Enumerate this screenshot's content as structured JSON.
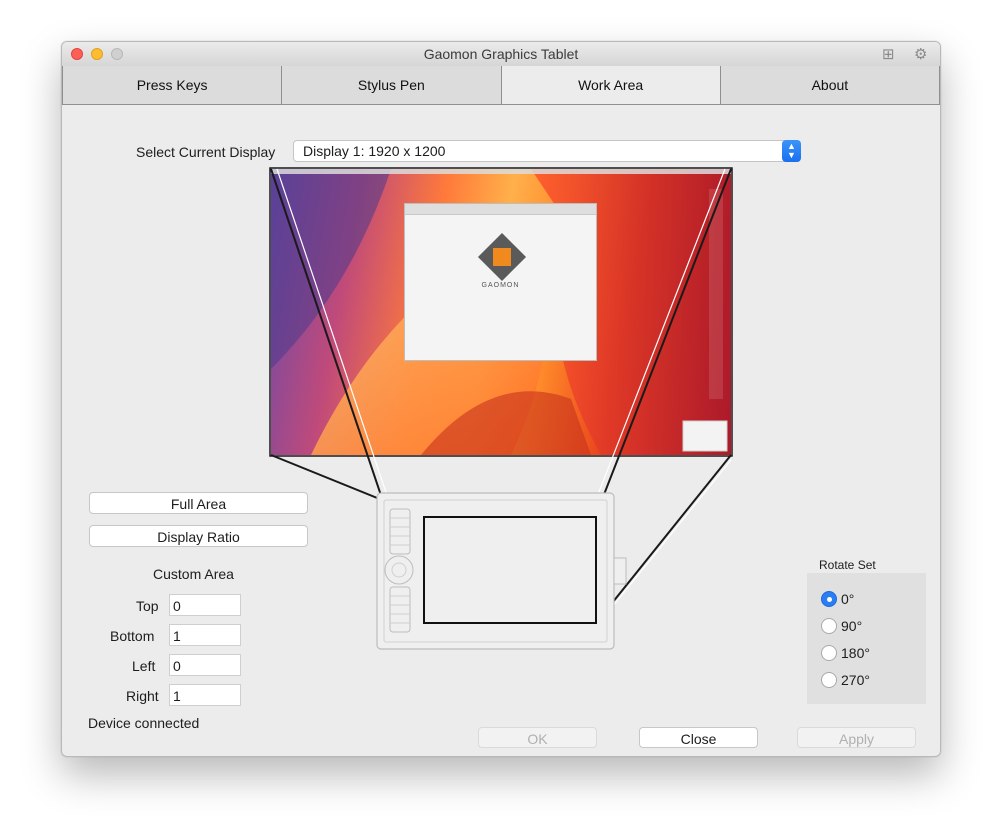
{
  "window": {
    "title": "Gaomon Graphics Tablet"
  },
  "tabs": [
    {
      "label": "Press Keys"
    },
    {
      "label": "Stylus Pen"
    },
    {
      "label": "Work Area"
    },
    {
      "label": "About"
    }
  ],
  "active_tab": "Work Area",
  "display": {
    "label": "Select Current Display",
    "value": "Display 1: 1920 x 1200"
  },
  "area_buttons": {
    "full": "Full Area",
    "ratio": "Display Ratio"
  },
  "custom": {
    "title": "Custom Area",
    "top_label": "Top",
    "top_value": "0",
    "bottom_label": "Bottom",
    "bottom_value": "1",
    "left_label": "Left",
    "left_value": "0",
    "right_label": "Right",
    "right_value": "1"
  },
  "status": "Device connected",
  "rotate": {
    "title": "Rotate Set",
    "options": [
      "0°",
      "90°",
      "180°",
      "270°"
    ],
    "selected": "0°"
  },
  "buttons": {
    "ok": "OK",
    "close": "Close",
    "apply": "Apply"
  },
  "preview": {
    "logo_text": "GAOMON"
  },
  "colors": {
    "accent": "#2b7df4"
  }
}
